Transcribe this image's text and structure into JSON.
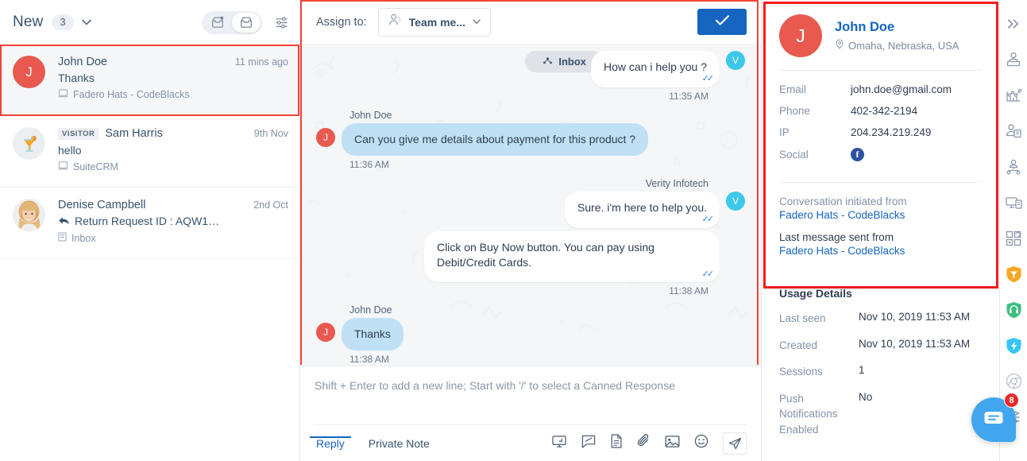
{
  "left": {
    "header": {
      "title": "New",
      "count": "3",
      "chevron_icon": "chevron-down-icon",
      "tray_unread_icon": "tray-unread-icon",
      "tray_icon": "tray-icon",
      "filter_icon": "filter-sliders-icon"
    },
    "conversations": [
      {
        "avatar_initial": "J",
        "avatar_type": "initial",
        "badge": "",
        "name": "John Doe",
        "time": "11 mins ago",
        "snippet": "Thanks",
        "snippet_icon": "",
        "source": "Fadero Hats - CodeBlacks",
        "source_icon": "website-icon",
        "selected": true
      },
      {
        "avatar_initial": "",
        "avatar_type": "drink",
        "badge": "VISITOR",
        "name": "Sam Harris",
        "time": "9th Nov",
        "snippet": "hello",
        "snippet_icon": "",
        "source": "SuiteCRM",
        "source_icon": "website-icon",
        "selected": false
      },
      {
        "avatar_initial": "",
        "avatar_type": "photo",
        "badge": "",
        "name": "Denise Campbell",
        "time": "2nd Oct",
        "snippet": "Return Request ID : AQW1…",
        "snippet_icon": "reply-arrow-icon",
        "source": "Inbox",
        "source_icon": "inbox-small-icon",
        "selected": false
      }
    ]
  },
  "middle": {
    "assign": {
      "label": "Assign to:",
      "selected": "Team me...",
      "person_icon": "assign-person-icon",
      "chevron_icon": "chevron-down-icon",
      "confirm_icon": "check-icon"
    },
    "messages": [
      {
        "type": "out",
        "tag": "Inbox",
        "tag_icon": "inbox-tag-icon",
        "sender": "",
        "text": "How can i help you ?",
        "time": "11:35 AM",
        "avatar": "V",
        "ticks": true
      },
      {
        "type": "in",
        "sender": "John Doe",
        "text": "Can you give me details about payment for this product ?",
        "time": "11:36 AM",
        "avatar": "J",
        "ticks": false
      },
      {
        "type": "out",
        "sender": "Verity Infotech",
        "text": "Sure. i'm here to help you.",
        "time": "",
        "avatar": "V",
        "ticks": true
      },
      {
        "type": "out",
        "sender": "",
        "text": "Click on Buy Now button. You can pay using Debit/Credit Cards.",
        "time": "11:38 AM",
        "avatar": "",
        "ticks": true
      },
      {
        "type": "in",
        "sender": "John Doe",
        "text": "Thanks",
        "time": "11:38 AM",
        "avatar": "J",
        "ticks": false
      }
    ],
    "composer": {
      "placeholder": "Shift + Enter to add a new line; Start with '/' to select a Canned Response",
      "value": "",
      "tabs": [
        {
          "label": "Reply",
          "active": true
        },
        {
          "label": "Private Note",
          "active": false
        }
      ],
      "tools": [
        "screen-share-icon",
        "canned-response-icon",
        "document-icon",
        "attachment-icon",
        "image-icon",
        "emoji-icon",
        "send-icon"
      ]
    }
  },
  "right": {
    "contact": {
      "avatar_initial": "J",
      "name": "John Doe",
      "location": "Omaha, Nebraska, USA",
      "location_icon": "location-pin-icon",
      "fields": [
        {
          "key": "Email",
          "value": "john.doe@gmail.com",
          "icon": ""
        },
        {
          "key": "Phone",
          "value": "402-342-2194",
          "icon": ""
        },
        {
          "key": "IP",
          "value": "204.234.219.249",
          "icon": ""
        },
        {
          "key": "Social",
          "value": "",
          "icon": "facebook-icon"
        }
      ],
      "origin_label": "Conversation initiated from",
      "origin_link": "Fadero Hats - CodeBlacks",
      "last_label": "Last message sent from",
      "last_link": "Fadero Hats - CodeBlacks"
    },
    "usage": {
      "title": "Usage Details",
      "rows": [
        {
          "key": "Last seen",
          "value": "Nov 10, 2019 11:53 AM"
        },
        {
          "key": "Created",
          "value": "Nov 10, 2019 11:53 AM"
        },
        {
          "key": "Sessions",
          "value": "1"
        },
        {
          "key": "Push Notifications Enabled",
          "value": "No"
        }
      ]
    }
  },
  "rail": {
    "items": [
      {
        "icon": "collapse-chevrons-icon",
        "color": "#8a97ad"
      },
      {
        "icon": "agent-desk-icon",
        "color": "#8a97ad"
      },
      {
        "icon": "analytics-chart-icon",
        "color": "#8a97ad"
      },
      {
        "icon": "contact-card-icon",
        "color": "#8a97ad"
      },
      {
        "icon": "org-chart-icon",
        "color": "#8a97ad"
      },
      {
        "icon": "device-screen-icon",
        "color": "#8a97ad"
      },
      {
        "icon": "apps-grid-icon",
        "color": "#8a97ad"
      },
      {
        "icon": "shield-badge-icon",
        "color": "#f5a623"
      },
      {
        "icon": "headphones-support-icon",
        "color": "#3fbf7f"
      },
      {
        "icon": "lightning-bolt-icon",
        "color": "#35c6f4"
      },
      {
        "icon": "chrome-browser-icon",
        "color": "#b9c2ce"
      },
      {
        "icon": "settings-sliders-icon",
        "color": "#7d8a9c"
      }
    ],
    "badge_count": "8",
    "fab_icon": "chat-bubble-icon"
  },
  "colors": {
    "accent_blue": "#1565c0",
    "avatar_red": "#e8594f",
    "avatar_cyan": "#3cc8e8",
    "highlight_red": "#f21d1d",
    "bubble_in": "#bfe0f5",
    "badge_red": "#ea2b2b"
  }
}
